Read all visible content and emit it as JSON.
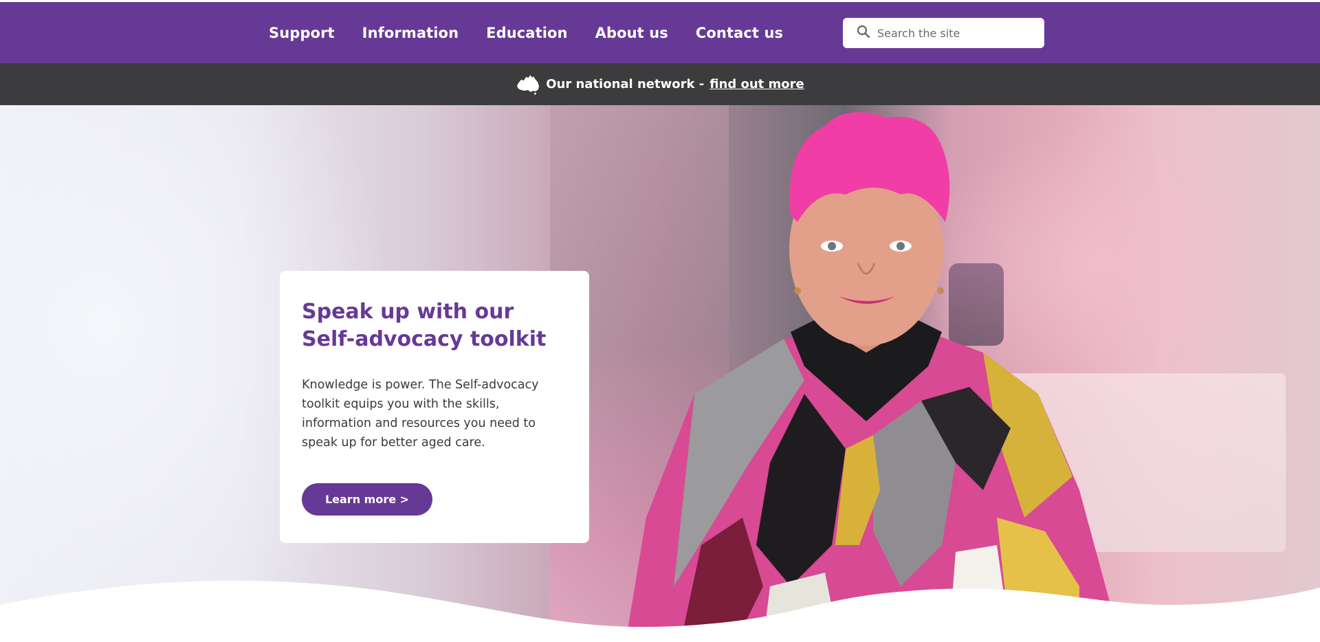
{
  "nav": {
    "items": [
      {
        "label": "Support"
      },
      {
        "label": "Information"
      },
      {
        "label": "Education"
      },
      {
        "label": "About us"
      },
      {
        "label": "Contact us"
      }
    ]
  },
  "search": {
    "placeholder": "Search the site"
  },
  "network": {
    "lead": "Our national network -",
    "link": "find out more",
    "icon": "australia-map-icon"
  },
  "hero": {
    "title": "Speak up with our Self-advocacy toolkit",
    "body": "Knowledge is power. The Self-advocacy toolkit equips you with the skills, information and resources you need to speak up for better aged care.",
    "button": "Learn more >"
  },
  "colors": {
    "brand": "#673996",
    "network_bar": "#3c3c3e"
  }
}
